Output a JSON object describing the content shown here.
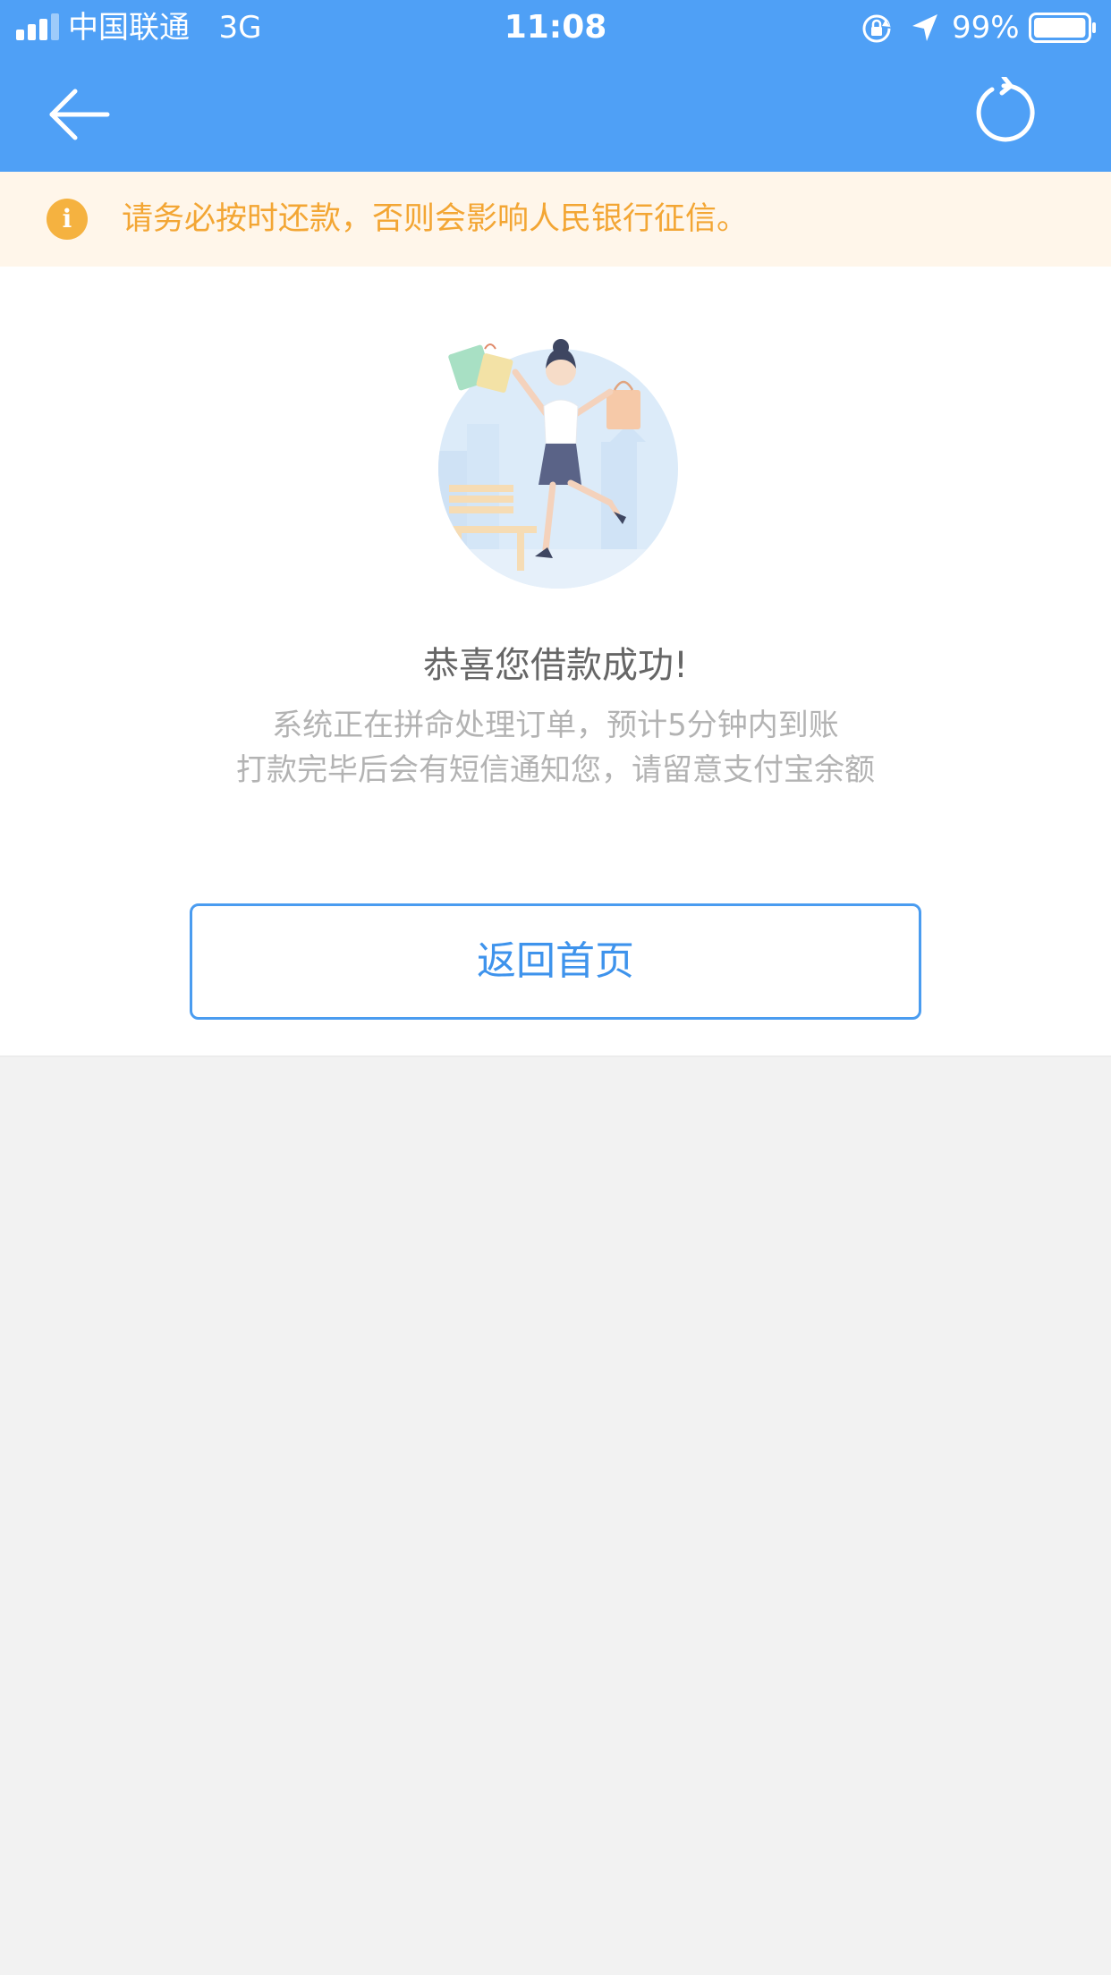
{
  "status_bar": {
    "carrier": "中国联通",
    "network": "3G",
    "time": "11:08",
    "battery": "99%",
    "battery_level": 0.99,
    "signal_bars": 3,
    "signal_bars_total": 4,
    "icons": [
      "signal-icon",
      "rotation-lock-icon",
      "location-arrow-icon",
      "battery-icon"
    ]
  },
  "nav": {
    "back_icon": "arrow-left-icon",
    "refresh_icon": "refresh-icon"
  },
  "notice": {
    "icon": "info-icon",
    "icon_glyph": "i",
    "text": "请务必按时还款，否则会影响人民银行征信。"
  },
  "result": {
    "illustration": "celebrating-woman-illustration",
    "title": "恭喜您借款成功!",
    "line1": "系统正在拼命处理订单，预计5分钟内到账",
    "line2": "打款完毕后会有短信通知您，请留意支付宝余额"
  },
  "actions": {
    "home_label": "返回首页"
  },
  "colors": {
    "primary": "#4fa0f6",
    "notice_bg": "#fff6ea",
    "notice_text": "#f3a634",
    "notice_icon": "#f5b240",
    "page_bg": "#f2f2f2",
    "button_border": "#4a9cf0"
  }
}
